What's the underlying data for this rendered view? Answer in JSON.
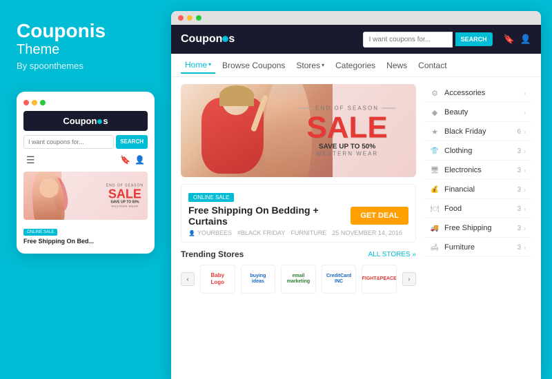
{
  "leftPanel": {
    "brandTitle": "Couponis",
    "brandSubtitle": "Theme",
    "brandBy": "By spoonthemes"
  },
  "mockup": {
    "logo": "Coupon",
    "logoDot": "●",
    "logoSuffix": "s",
    "searchPlaceholder": "I want coupons for...",
    "searchBtn": "SEARCH",
    "banner": {
      "eos": "END OF SEASON",
      "sale": "SALE",
      "save": "SAVE UP TO 50%",
      "western": "WESTERN WEAR"
    },
    "badge": "ONLINE SALE",
    "dealTitle": "Free Shipping On Bed..."
  },
  "browser": {
    "titlebar": {
      "dots": [
        "red",
        "yellow",
        "green"
      ]
    },
    "header": {
      "logo": "Coupon",
      "logoDot": "●",
      "logoSuffix": "s",
      "searchPlaceholder": "I want coupons for...",
      "searchBtn": "SEARCH"
    },
    "subnav": [
      {
        "label": "Home",
        "active": true,
        "hasChevron": true
      },
      {
        "label": "Browse Coupons",
        "active": false,
        "hasChevron": false
      },
      {
        "label": "Stores",
        "active": false,
        "hasChevron": true
      },
      {
        "label": "Categories",
        "active": false,
        "hasChevron": false
      },
      {
        "label": "News",
        "active": false,
        "hasChevron": false
      },
      {
        "label": "Contact",
        "active": false,
        "hasChevron": false
      }
    ],
    "heroBanner": {
      "eos": "END OF SEASON",
      "sale": "SALE",
      "save": "SAVE UP TO 50%",
      "western": "WESTERN WEAR"
    },
    "deal": {
      "badge": "ONLINE SALE",
      "title": "Free Shipping On Bedding + Curtains",
      "getBtn": "GET DEAL",
      "metaUser": "YOURBEES",
      "metaTag1": "#BLACK FRIDAY",
      "metaTag2": "FURNITURE",
      "metaDate": "25 NOVEMBER 14, 2016"
    },
    "trending": {
      "title": "Trending Stores",
      "allStores": "ALL STORES »",
      "stores": [
        {
          "name": "babylogo",
          "display": "Baby\nLogo"
        },
        {
          "name": "buyingideas",
          "display": "BuyingIdeas"
        },
        {
          "name": "emailmarketing",
          "display": "email\nmarketing"
        },
        {
          "name": "creditcardinc",
          "display": "CreditCard\nINC"
        },
        {
          "name": "fightpeace",
          "display": "FIGHT&PEACE"
        }
      ]
    },
    "sidebar": {
      "categories": [
        {
          "icon": "⚙",
          "label": "Accessories",
          "count": ""
        },
        {
          "icon": "◆",
          "label": "Beauty",
          "count": ""
        },
        {
          "icon": "★",
          "label": "Black Friday",
          "count": "6"
        },
        {
          "icon": "👕",
          "label": "Clothing",
          "count": "3"
        },
        {
          "icon": "🖥",
          "label": "Electronics",
          "count": "3"
        },
        {
          "icon": "💰",
          "label": "Financial",
          "count": "3"
        },
        {
          "icon": "🍽",
          "label": "Food",
          "count": "3"
        },
        {
          "icon": "🚚",
          "label": "Free Shipping",
          "count": "3"
        },
        {
          "icon": "🛋",
          "label": "Furniture",
          "count": "3"
        }
      ]
    }
  },
  "colors": {
    "primary": "#00bcd4",
    "accent": "#e53935",
    "orange": "#ffa000",
    "dark": "#1a1a2e"
  }
}
